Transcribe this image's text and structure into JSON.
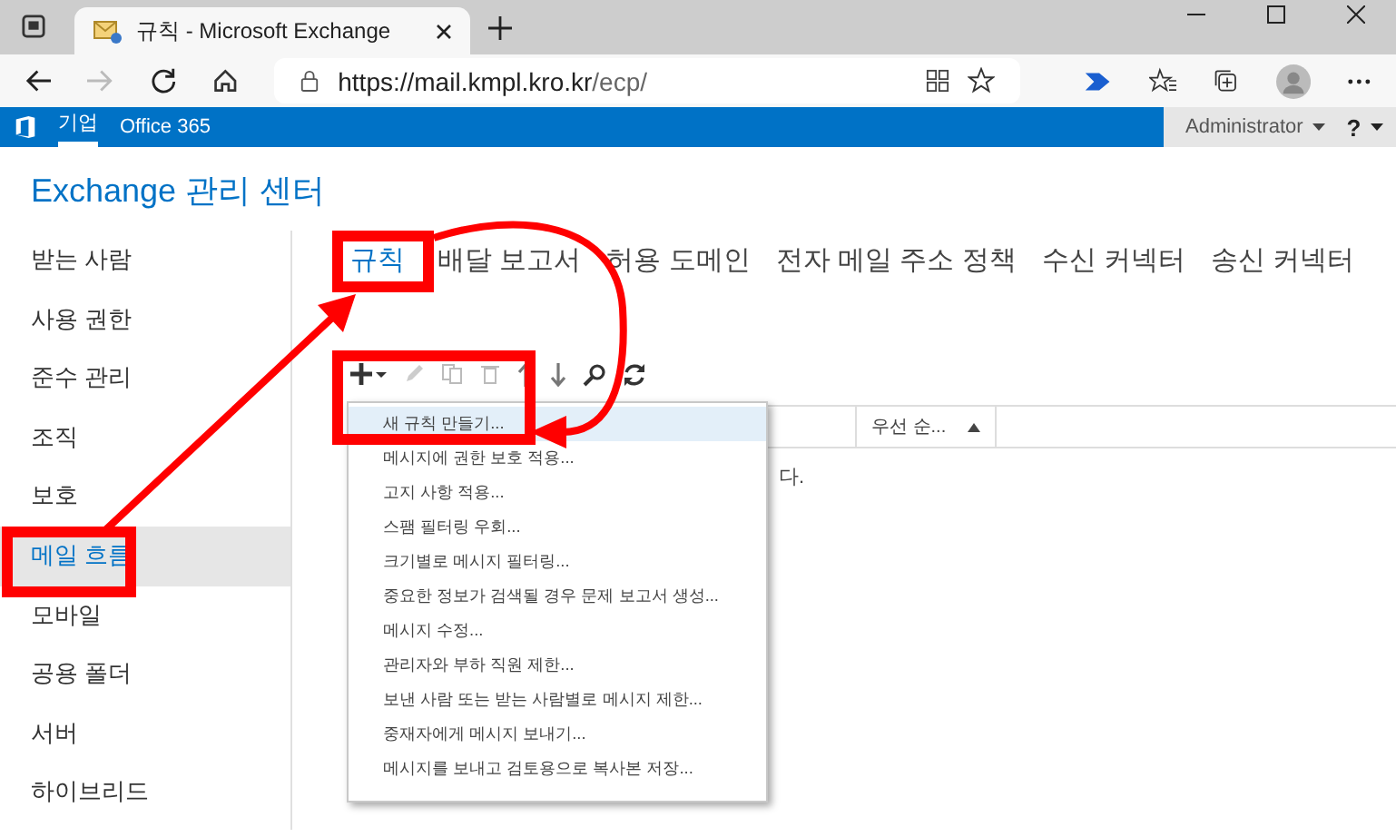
{
  "browser": {
    "tab_title": "규칙 - Microsoft Exchange",
    "url_host": "https://mail.kmpl.kro.kr",
    "url_path": "/ecp/"
  },
  "header": {
    "links": [
      {
        "label": "기업",
        "selected": true
      },
      {
        "label": "Office 365",
        "selected": false
      }
    ],
    "user": "Administrator",
    "help": "?"
  },
  "title": "Exchange 관리 센터",
  "sidebar": {
    "items": [
      {
        "label": "받는 사람",
        "selected": false
      },
      {
        "label": "사용 권한",
        "selected": false
      },
      {
        "label": "준수 관리",
        "selected": false
      },
      {
        "label": "조직",
        "selected": false
      },
      {
        "label": "보호",
        "selected": false
      },
      {
        "label": "메일 흐름",
        "selected": true
      },
      {
        "label": "모바일",
        "selected": false
      },
      {
        "label": "공용 폴더",
        "selected": false
      },
      {
        "label": "서버",
        "selected": false
      },
      {
        "label": "하이브리드",
        "selected": false
      }
    ]
  },
  "tabs": [
    {
      "label": "규칙",
      "selected": true
    },
    {
      "label": "배달 보고서",
      "selected": false
    },
    {
      "label": "허용 도메인",
      "selected": false
    },
    {
      "label": "전자 메일 주소 정책",
      "selected": false
    },
    {
      "label": "수신 커넥터",
      "selected": false
    },
    {
      "label": "송신 커넥터",
      "selected": false
    }
  ],
  "table": {
    "columns": [
      {
        "label": "우선 순...",
        "sorted_ascending": true
      }
    ],
    "empty_text": "다."
  },
  "menu": {
    "items": [
      {
        "label": "새 규칙 만들기...",
        "selected": true
      },
      {
        "label": "메시지에 권한 보호 적용...",
        "selected": false
      },
      {
        "label": "고지 사항 적용...",
        "selected": false
      },
      {
        "label": "스팸 필터링 우회...",
        "selected": false
      },
      {
        "label": "크기별로 메시지 필터링...",
        "selected": false
      },
      {
        "label": "중요한 정보가 검색될 경우 문제 보고서 생성...",
        "selected": false
      },
      {
        "label": "메시지 수정...",
        "selected": false
      },
      {
        "label": "관리자와 부하 직원 제한...",
        "selected": false
      },
      {
        "label": "보낸 사람 또는 받는 사람별로 메시지 제한...",
        "selected": false
      },
      {
        "label": "중재자에게 메시지 보내기...",
        "selected": false
      },
      {
        "label": "메시지를 보내고 검토용으로 복사본 저장...",
        "selected": false
      }
    ]
  }
}
